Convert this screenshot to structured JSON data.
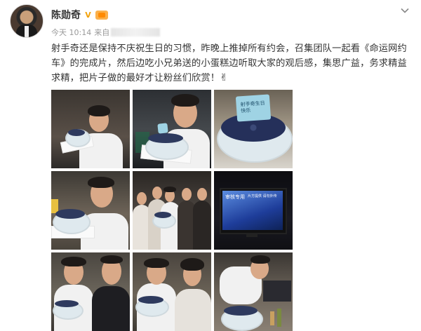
{
  "header": {
    "author": "陈勋奇",
    "verified_mark": "V",
    "timestamp": "今天 10:14",
    "source_prefix": "来自"
  },
  "post": {
    "text": "射手奇还是保持不庆祝生日的习惯，昨晚上推掉所有约会，召集团队一起看《命运网约车》的完成片，然后边吃小兄弟送的小蛋糕边听取大家的观后感，集思广益，务求精益求精，把片子做的最好才让粉丝们欣赏！",
    "emoji": "✌"
  },
  "photos": [
    {
      "name": "photo-1",
      "desc": "man in white hoodie holding cake"
    },
    {
      "name": "photo-2",
      "desc": "man smiling with cake in studio"
    },
    {
      "name": "photo-3",
      "desc": "close-up of blueberry cake with card"
    },
    {
      "name": "photo-4",
      "desc": "man holding cake in office"
    },
    {
      "name": "photo-5",
      "desc": "group photo with cake"
    },
    {
      "name": "photo-6",
      "desc": "TV screen showing film"
    },
    {
      "name": "photo-7",
      "desc": "man with another man giving thumbs up"
    },
    {
      "name": "photo-8",
      "desc": "man with woman giving thumbs up"
    },
    {
      "name": "photo-9",
      "desc": "man cutting cake"
    }
  ],
  "cake_card_text": "射手奇生日快乐",
  "tv_caption_left": "审核专用",
  "tv_caption_right": "片方提供 请勿外传",
  "icons": {
    "verified": "verified-v-icon",
    "member": "member-badge-icon",
    "menu": "chevron-down-icon"
  },
  "colors": {
    "verified": "#f2a20b",
    "member": "#ff8a00",
    "text": "#333333",
    "meta": "#999999"
  }
}
